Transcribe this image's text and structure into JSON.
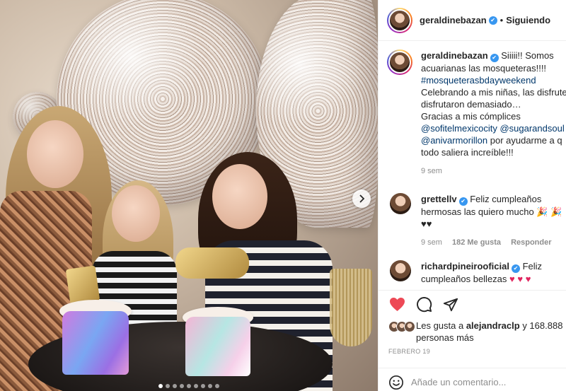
{
  "header": {
    "username": "geraldinebazan",
    "separator": "•",
    "follow_state": "Siguiendo"
  },
  "caption": {
    "username": "geraldinebazan",
    "line1": "Siiiii!! Somos",
    "line2": "acuarianas las mosqueteras!!!!",
    "hashtag": "#mosqueterasbdayweekend",
    "line4": "Celebrando a mis niñas, las disfrute",
    "line5": "disfrutaron demasiado…",
    "line6": "Gracias a mis cómplices",
    "mention1": "@sofitelmexicocity",
    "mention2": "@sugarandsoul",
    "mention3": "@anivarmorillon",
    "line8_rest": " por ayudarme a q",
    "line9": "todo saliera increíble!!!",
    "time": "9 sem"
  },
  "comments": [
    {
      "username": "grettellv",
      "line1": "Feliz cumpleaños",
      "line2": "hermosas las quiero mucho",
      "line2_emoji": "🎉 🎉",
      "line3": "♥♥",
      "time": "9 sem",
      "likes": "182 Me gusta",
      "reply": "Responder"
    },
    {
      "username": "richardpineirooficial",
      "line1": "Feliz",
      "line2": "cumpleaños bellezas",
      "line2_emoji": "♥ ♥ ♥"
    }
  ],
  "likes": {
    "prefix": "Les gusta a ",
    "user": "alejandraclp",
    "middle": " y 168.888",
    "line2": "personas más"
  },
  "date": "FEBRERO 19",
  "add_comment": {
    "placeholder": "Añade un comentario..."
  },
  "carousel": {
    "slide_count": 9,
    "active_index": 0
  },
  "icons": {
    "like": "heart-icon",
    "comment": "comment-icon",
    "share": "share-icon",
    "emoji": "emoji-icon",
    "verified": "verified-badge-icon",
    "next": "chevron-right-icon"
  },
  "colors": {
    "like_active": "#ed4956",
    "link": "#00376b",
    "verified": "#3897f0",
    "muted": "#8e8e8e"
  }
}
